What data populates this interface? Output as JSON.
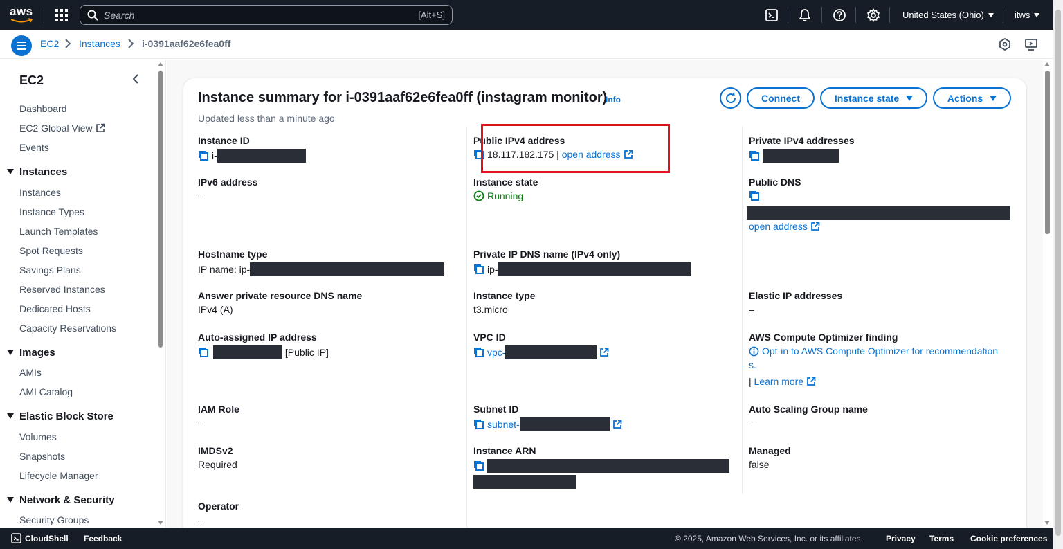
{
  "topnav": {
    "logo_text": "aws",
    "search_placeholder": "Search",
    "search_shortcut": "[Alt+S]",
    "region": "United States (Ohio)",
    "account": "itws"
  },
  "breadcrumb": {
    "items": [
      "EC2",
      "Instances"
    ],
    "current": "i-0391aaf62e6fea0ff"
  },
  "sidebar": {
    "title": "EC2",
    "top_items": [
      "Dashboard",
      "EC2 Global View",
      "Events"
    ],
    "sections": [
      {
        "title": "Instances",
        "items": [
          "Instances",
          "Instance Types",
          "Launch Templates",
          "Spot Requests",
          "Savings Plans",
          "Reserved Instances",
          "Dedicated Hosts",
          "Capacity Reservations"
        ]
      },
      {
        "title": "Images",
        "items": [
          "AMIs",
          "AMI Catalog"
        ]
      },
      {
        "title": "Elastic Block Store",
        "items": [
          "Volumes",
          "Snapshots",
          "Lifecycle Manager"
        ]
      },
      {
        "title": "Network & Security",
        "items": [
          "Security Groups"
        ]
      }
    ]
  },
  "summary": {
    "title": "Instance summary for i-0391aaf62e6fea0ff (instagram monitor)",
    "info": "Info",
    "updated": "Updated less than a minute ago",
    "buttons": {
      "connect": "Connect",
      "instance_state": "Instance state",
      "actions": "Actions"
    },
    "fields": {
      "instance_id": {
        "label": "Instance ID",
        "value": "i-"
      },
      "public_ipv4": {
        "label": "Public IPv4 address",
        "value": "18.117.182.175",
        "sep": "|",
        "link": "open address"
      },
      "private_ipv4": {
        "label": "Private IPv4 addresses"
      },
      "ipv6": {
        "label": "IPv6 address",
        "value": "–"
      },
      "instance_state": {
        "label": "Instance state",
        "value": "Running"
      },
      "public_dns": {
        "label": "Public DNS",
        "link": "open address"
      },
      "hostname_type": {
        "label": "Hostname type",
        "value": "IP name: ip-"
      },
      "private_ip_dns": {
        "label": "Private IP DNS name (IPv4 only)",
        "value": "ip-"
      },
      "answer_dns": {
        "label": "Answer private resource DNS name",
        "value": "IPv4 (A)"
      },
      "instance_type": {
        "label": "Instance type",
        "value": "t3.micro"
      },
      "elastic_ip": {
        "label": "Elastic IP addresses",
        "value": "–"
      },
      "auto_ip": {
        "label": "Auto-assigned IP address",
        "value": "[Public IP]"
      },
      "vpc_id": {
        "label": "VPC ID",
        "value": "vpc-"
      },
      "optimizer": {
        "label": "AWS Compute Optimizer finding",
        "link1": "Opt-in to AWS Compute Optimizer for recommendation",
        "link1b": "s.",
        "sep": "|",
        "link2": "Learn more"
      },
      "iam_role": {
        "label": "IAM Role",
        "value": "–"
      },
      "subnet_id": {
        "label": "Subnet ID",
        "value": "subnet-"
      },
      "asg_name": {
        "label": "Auto Scaling Group name",
        "value": "–"
      },
      "imdsv2": {
        "label": "IMDSv2",
        "value": "Required"
      },
      "instance_arn": {
        "label": "Instance ARN"
      },
      "managed": {
        "label": "Managed",
        "value": "false"
      },
      "operator": {
        "label": "Operator",
        "value": "–"
      }
    }
  },
  "footer": {
    "cloudshell": "CloudShell",
    "feedback": "Feedback",
    "copyright": "© 2025, Amazon Web Services, Inc. or its affiliates.",
    "privacy": "Privacy",
    "terms": "Terms",
    "cookies": "Cookie preferences"
  }
}
